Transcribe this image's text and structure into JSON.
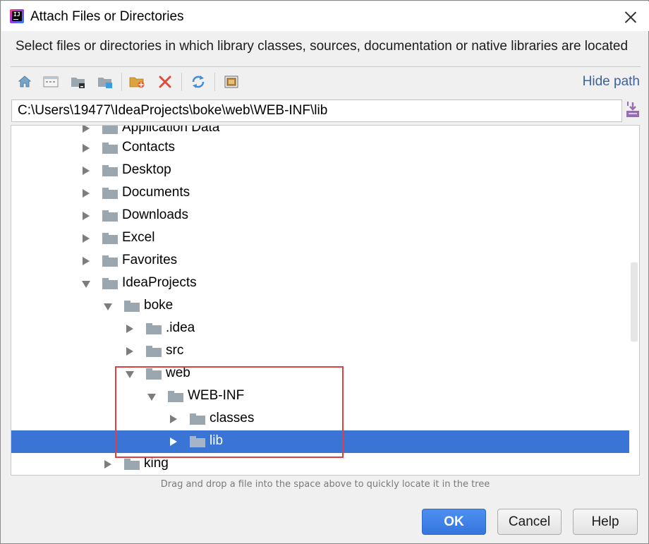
{
  "window": {
    "title": "Attach Files or Directories",
    "app_icon_text": "IJ"
  },
  "description": "Select files or directories in which library classes, sources, documentation or native libraries are located",
  "toolbar": {
    "hide_path_label": "Hide path",
    "icons": [
      "home-icon",
      "desktop-icon",
      "project-folder-icon",
      "module-folder-icon",
      "new-folder-icon",
      "delete-icon",
      "refresh-icon",
      "show-hidden-icon"
    ]
  },
  "path": {
    "value": "C:\\Users\\19477\\IdeaProjects\\boke\\web\\WEB-INF\\lib"
  },
  "tree": {
    "rows": [
      {
        "label": "Application Data",
        "expanded": false
      },
      {
        "label": "Contacts",
        "expanded": false
      },
      {
        "label": "Desktop",
        "expanded": false
      },
      {
        "label": "Documents",
        "expanded": false
      },
      {
        "label": "Downloads",
        "expanded": false
      },
      {
        "label": "Excel",
        "expanded": false
      },
      {
        "label": "Favorites",
        "expanded": false
      },
      {
        "label": "IdeaProjects",
        "expanded": true
      },
      {
        "label": "boke",
        "expanded": true
      },
      {
        "label": ".idea",
        "expanded": false
      },
      {
        "label": "src",
        "expanded": false
      },
      {
        "label": "web",
        "expanded": true
      },
      {
        "label": "WEB-INF",
        "expanded": true
      },
      {
        "label": "classes",
        "expanded": false
      },
      {
        "label": "lib",
        "expanded": false,
        "selected": true
      },
      {
        "label": "king",
        "expanded": false
      }
    ]
  },
  "hint": "Drag and drop a file into the space above to quickly locate it in the tree",
  "buttons": {
    "ok": "OK",
    "cancel": "Cancel",
    "help": "Help"
  },
  "colors": {
    "selection": "#3a75d6",
    "link": "#3e6398",
    "highlight_box": "#e04040",
    "ok_button": "#3476de"
  }
}
